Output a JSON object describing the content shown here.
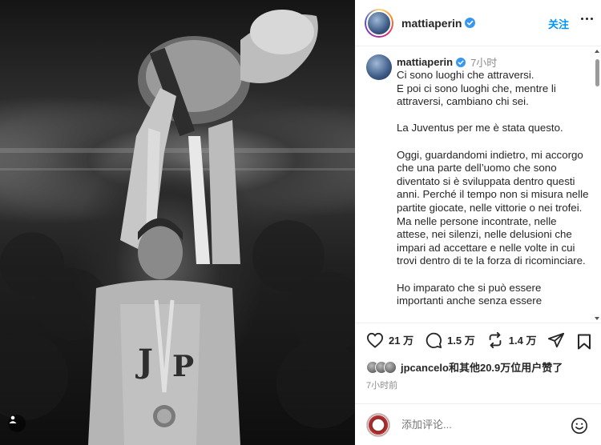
{
  "post": {
    "username": "mattiaperin",
    "follow_label": "关注",
    "caption_time": "7小时",
    "caption_text": "Ci sono luoghi che attraversi.\nE poi ci sono luoghi che, mentre li attraversi, cambiano chi sei.\n\nLa Juventus per me è stata questo.\n\nOggi, guardandomi indietro, mi accorgo che una parte dell’uomo che sono diventato si è sviluppata dentro questi anni. Perché il tempo non si misura nelle partite giocate, nelle vittorie o nei trofei. Ma nelle persone incontrate, nelle attese, nei silenzi, nelle delusioni che impari ad accettare e nelle volte in cui trovi dentro di te la forza di ricominciare.\n\nHo imparato che si può essere importanti anche senza essere",
    "likes_count": "21 万",
    "comments_count": "1.5 万",
    "reposts_count": "1.4 万",
    "liked_by": "jpcancelo和其他20.9万位用户赞了",
    "posted_time": "7小时前",
    "comment_placeholder": "添加评论..."
  },
  "icons": {
    "verified": "verified-badge-icon",
    "more": "more-options-icon",
    "like": "heart-icon",
    "comment": "comment-bubble-icon",
    "repost": "repost-icon",
    "share": "paper-plane-icon",
    "save": "bookmark-icon",
    "emoji": "emoji-icon",
    "user_tag": "user-tag-icon"
  },
  "colors": {
    "accent": "#0095f6",
    "verified": "#3897f0",
    "text": "#262626",
    "muted": "#8e8e8e"
  }
}
